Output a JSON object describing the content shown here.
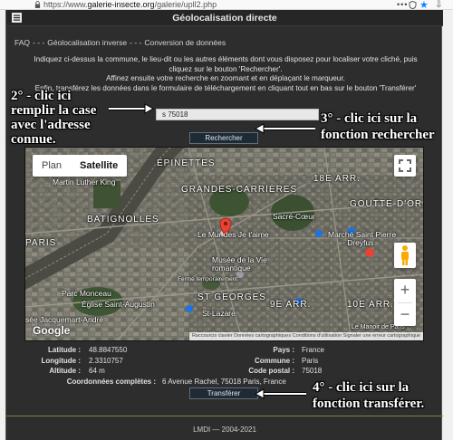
{
  "browser": {
    "url_prefix": "https://www.",
    "url_domain": "galerie-insecte.org",
    "url_path": "/galerie/upll2.php",
    "page_actions": "•••"
  },
  "titlebar": {
    "title": "Géolocalisation directe"
  },
  "nav": {
    "prefix": "FAQ",
    "separator": "- - -",
    "link1": "Géolocalisation inverse",
    "link2": "Conversion de données"
  },
  "intro": {
    "line1": "Indiquez ci-dessus la commune, le lieu-dit ou les autres éléments dont vous disposez pour localiser votre cliché, puis",
    "line2": "cliquez sur le bouton 'Rechercher'.",
    "line3": "Affinez ensuite votre recherche en zoomant et en déplaçant le marqueur.",
    "line4": "Enfin, transférez les données dans le formulaire de téléchargement en cliquant tout en bas sur le bouton 'Transférer'"
  },
  "search": {
    "value": "s 75018"
  },
  "buttons": {
    "search": "Rechercher",
    "transfer": "Transférer"
  },
  "map": {
    "type_plan": "Plan",
    "type_satellite": "Satellite",
    "selected_type": "Satellite",
    "labels": {
      "epinettes": "ÉPINETTES",
      "mlk": "Martin Luther King",
      "grandes_carrieres": "GRANDES-CARRIÈRES",
      "arr18": "18E ARR.",
      "goutte": "GOUTTE-D'OR",
      "batignolles": "BATIGNOLLES",
      "sacre": "Sacré-Cœur",
      "murs": "Le Mur des Je t'aime",
      "marche": "Marché Saint Pierre",
      "dreyfus": "- Dreyfus",
      "paris": "PARIS",
      "musee": "Musée de la Vie romantique",
      "ferme": "Fermé temporairement",
      "parc": "Parc Monceau",
      "eglise": "Église Saint-Augustin",
      "stgeorges": "ST GEORGES",
      "arr9": "9E ARR.",
      "arr10": "10E ARR.",
      "stlazare": "St-Lazare",
      "jacquemart": "sée Jacquemart-André",
      "manoir": "Le Manoir de Paris"
    },
    "google": "Google",
    "attribution": "Raccourcis clavier   Données cartographiques   Conditions d'utilisation   Signaler une erreur cartographique"
  },
  "results": {
    "latitude_label": "Latitude :",
    "latitude": "48.8847550",
    "longitude_label": "Longitude :",
    "longitude": "2.3310757",
    "altitude_label": "Altitude :",
    "altitude": "64 m",
    "pays_label": "Pays :",
    "pays": "France",
    "commune_label": "Commune :",
    "commune": "Paris",
    "cp_label": "Code postal :",
    "cp": "75018",
    "coords_label": "Coordonnées complètes :",
    "coords": "6 Avenue Rachel, 75018 Paris, France"
  },
  "footer": {
    "text": "LMDI — 2004-2021"
  },
  "annotations": {
    "a1_line1": "2° - clic ici",
    "a1_line2": "remplir la case",
    "a1_line3": "avec l'adresse",
    "a1_line4": "connue.",
    "a3_line1": "3° - clic ici sur la",
    "a3_line2": "fonction rechercher",
    "a4_line1": "4° - clic ici sur la",
    "a4_line2": "fonction transférer."
  },
  "colors": {
    "page_bg": "#2d2d2d",
    "button_bg": "#1f2a33",
    "marker": "#ea4335",
    "footer_rule": "#8a7f3c"
  }
}
